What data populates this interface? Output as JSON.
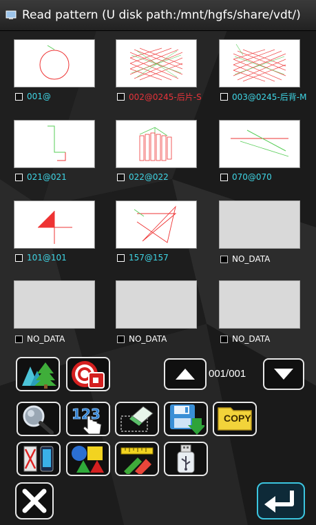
{
  "window": {
    "title": "Read pattern (U disk path:/mnt/hgfs/share/vdt/)"
  },
  "patterns": [
    {
      "label": "001@",
      "color": "cyan",
      "has_data": true,
      "checked": false
    },
    {
      "label": "002@0245-后片-S",
      "color": "red",
      "has_data": true,
      "checked": false
    },
    {
      "label": "003@0245-后背-M",
      "color": "cyan",
      "has_data": true,
      "checked": false
    },
    {
      "label": "021@021",
      "color": "cyan",
      "has_data": true,
      "checked": false
    },
    {
      "label": "022@022",
      "color": "cyan",
      "has_data": true,
      "checked": false
    },
    {
      "label": "070@070",
      "color": "cyan",
      "has_data": true,
      "checked": false
    },
    {
      "label": "101@101",
      "color": "cyan",
      "has_data": true,
      "checked": false
    },
    {
      "label": "157@157",
      "color": "cyan",
      "has_data": true,
      "checked": false
    },
    {
      "label": "NO_DATA",
      "color": "white",
      "has_data": false,
      "checked": false
    },
    {
      "label": "NO_DATA",
      "color": "white",
      "has_data": false,
      "checked": false
    },
    {
      "label": "NO_DATA",
      "color": "white",
      "has_data": false,
      "checked": false
    },
    {
      "label": "NO_DATA",
      "color": "white",
      "has_data": false,
      "checked": false
    }
  ],
  "pager": {
    "text": "001/001"
  },
  "toolbar": {
    "copy_label": "COPY"
  },
  "colors": {
    "cyan": "#3fd6e6",
    "red": "#e8333a",
    "stitch_red": "#e33",
    "stitch_green": "#5c5"
  }
}
